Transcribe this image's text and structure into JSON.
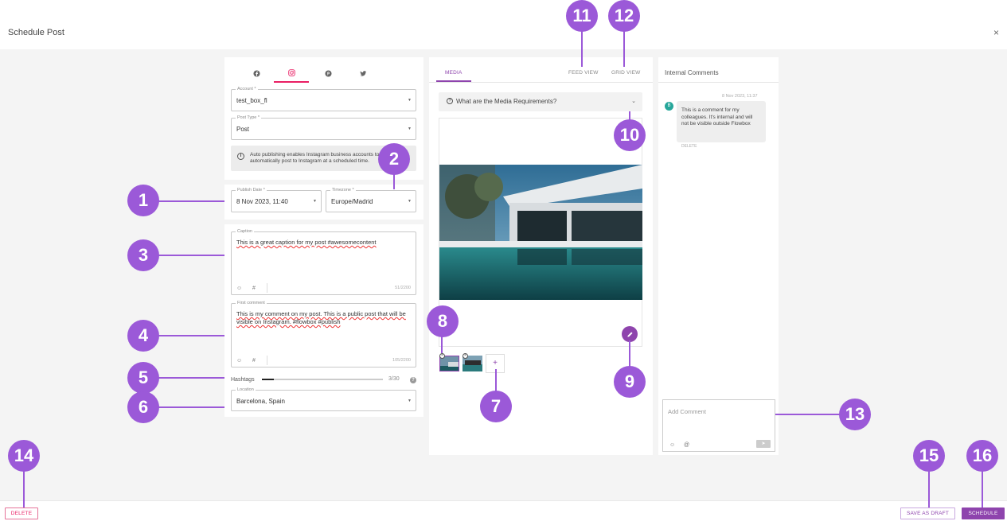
{
  "header": {
    "title": "Schedule Post",
    "close": "×"
  },
  "social_tabs": [
    "facebook",
    "instagram",
    "pinterest",
    "twitter"
  ],
  "account": {
    "label": "Account *",
    "value": "test_box_fl"
  },
  "post_type": {
    "label": "Post Type *",
    "value": "Post"
  },
  "info_text": "Auto publishing enables Instagram business accounts to automatically post to Instagram at a scheduled time.",
  "publish_date": {
    "label": "Publish Date *",
    "value": "8 Nov 2023, 11:40"
  },
  "timezone": {
    "label": "Timezone *",
    "value": "Europe/Madrid"
  },
  "caption": {
    "label": "Caption",
    "value": "This is a great caption for my post #awesomecontent",
    "count": "51/2200"
  },
  "first_comment": {
    "label": "First comment",
    "value": "This is my comment on my post. This is a public post that will be visible on Instagram. #flowbox #publish",
    "count": "105/2200"
  },
  "hashtags": {
    "label": "Hashtags",
    "count": "3/30",
    "fraction": 0.1
  },
  "location": {
    "label": "Location",
    "value": "Barcelona, Spain"
  },
  "media": {
    "tab_media": "MEDIA",
    "tab_feed": "FEED VIEW",
    "tab_grid": "GRID VIEW",
    "requirements": "What are the Media Requirements?"
  },
  "comments": {
    "title": "Internal Comments",
    "timestamp": "8 Nov 2023, 11:37",
    "avatar": "B",
    "text": "This is a comment for my colleagues. It's internal and will not be visible outside Flowbox",
    "delete": "DELETE",
    "placeholder": "Add Comment"
  },
  "footer": {
    "delete": "DELETE",
    "draft": "SAVE AS DRAFT",
    "schedule": "SCHEDULE"
  },
  "callouts": [
    "1",
    "2",
    "3",
    "4",
    "5",
    "6",
    "7",
    "8",
    "9",
    "10",
    "11",
    "12",
    "13",
    "14",
    "15",
    "16"
  ],
  "colors": {
    "accent": "#8e44ad",
    "callout": "#9b59d8",
    "instagram": "#e91e63"
  }
}
